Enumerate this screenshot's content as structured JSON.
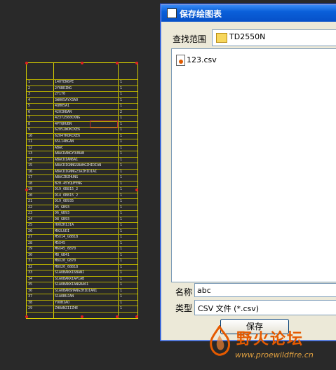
{
  "dialog": {
    "title": "保存绘图表",
    "lookin_label": "查找范围",
    "lookin_value": "TD2550N",
    "file_name_label": "名称",
    "file_name_value": "abc",
    "file_type_label": "类型",
    "file_type_value": "CSV 文件 (*.csv)",
    "save_label": "保存",
    "files": [
      "123.csv"
    ]
  },
  "table": {
    "rows": [
      {
        "num": "1",
        "name": "140TEN6PE",
        "qty": "1"
      },
      {
        "num": "2",
        "name": "2Y6BEING",
        "qty": "1"
      },
      {
        "num": "3",
        "name": "2Y170",
        "qty": "1"
      },
      {
        "num": "4",
        "name": "3WH05AYX3A0",
        "qty": "1"
      },
      {
        "num": "5",
        "name": "4QH05A1",
        "qty": "1"
      },
      {
        "num": "6",
        "name": "420IHBAN",
        "qty": "2"
      },
      {
        "num": "7",
        "name": "42372560CKNG",
        "qty": "1"
      },
      {
        "num": "8",
        "name": "4PYQHUBN",
        "qty": "1"
      },
      {
        "num": "9",
        "name": "62052WOKCKE6",
        "qty": "1"
      },
      {
        "num": "10",
        "name": "62047KOKCKE6",
        "qty": "1"
      },
      {
        "num": "11",
        "name": "65L14BGAN",
        "qty": "1"
      },
      {
        "num": "12",
        "name": "ABAC",
        "qty": "1"
      },
      {
        "num": "13",
        "name": "ABACDANGYOUBAB",
        "qty": "1"
      },
      {
        "num": "14",
        "name": "ABACDIAN6A1",
        "qty": "1"
      },
      {
        "num": "15",
        "name": "ABACDIGNNGSBAHGZHIDIAN",
        "qty": "1"
      },
      {
        "num": "16",
        "name": "ABACDIGNNG23AZHIDIAI",
        "qty": "1"
      },
      {
        "num": "17",
        "name": "ABACZBZHUNG",
        "qty": "1"
      },
      {
        "num": "18",
        "name": "B20-45YQUFENG",
        "qty": "1"
      },
      {
        "num": "19",
        "name": "D19_6B815_2",
        "qty": "1"
      },
      {
        "num": "20",
        "name": "D14_6B815_2",
        "qty": "1"
      },
      {
        "num": "21",
        "name": "D19_6B935",
        "qty": "1"
      },
      {
        "num": "22",
        "name": "D5_GB93",
        "qty": "1"
      },
      {
        "num": "23",
        "name": "D6_GB93",
        "qty": "1"
      },
      {
        "num": "24",
        "name": "D8_GB93",
        "qty": "1"
      },
      {
        "num": "25",
        "name": "HOUZHIJIA",
        "qty": "1"
      },
      {
        "num": "26",
        "name": "M02LUDI",
        "qty": "1"
      },
      {
        "num": "27",
        "name": "M5X14_GB818",
        "qty": "1"
      },
      {
        "num": "28",
        "name": "M5X45",
        "qty": "1"
      },
      {
        "num": "29",
        "name": "M6X45_6B70",
        "qty": "1"
      },
      {
        "num": "30",
        "name": "M8_GB41",
        "qty": "1"
      },
      {
        "num": "31",
        "name": "M8X20_GB70",
        "qty": "1"
      },
      {
        "num": "32",
        "name": "M8X20_6B818",
        "qty": "1"
      },
      {
        "num": "33",
        "name": "S1AOBANXI6BANI",
        "qty": "1"
      },
      {
        "num": "34",
        "name": "S1AOBANXIAP1AB",
        "qty": "1"
      },
      {
        "num": "35",
        "name": "S1AOBANXIANGBA61",
        "qty": "1"
      },
      {
        "num": "36",
        "name": "S1AOBANSHANGZHIDIAN1",
        "qty": "1"
      },
      {
        "num": "37",
        "name": "S1AOBUJAN",
        "qty": "1"
      },
      {
        "num": "38",
        "name": "YOUBIAO",
        "qty": "1"
      },
      {
        "num": "29",
        "name": "ZHUANZIIZHE",
        "qty": "1"
      }
    ]
  },
  "watermark": {
    "text": "野火论坛",
    "url": "www.proewildfire.cn"
  },
  "colors": {
    "background": "#292929",
    "table_line": "#d8d000",
    "table_text": "#e0e0e0",
    "grip": "#e02020",
    "titlebar": "#0a5fd9",
    "dialog_bg": "#ece9d8",
    "watermark": "#e55a00"
  }
}
